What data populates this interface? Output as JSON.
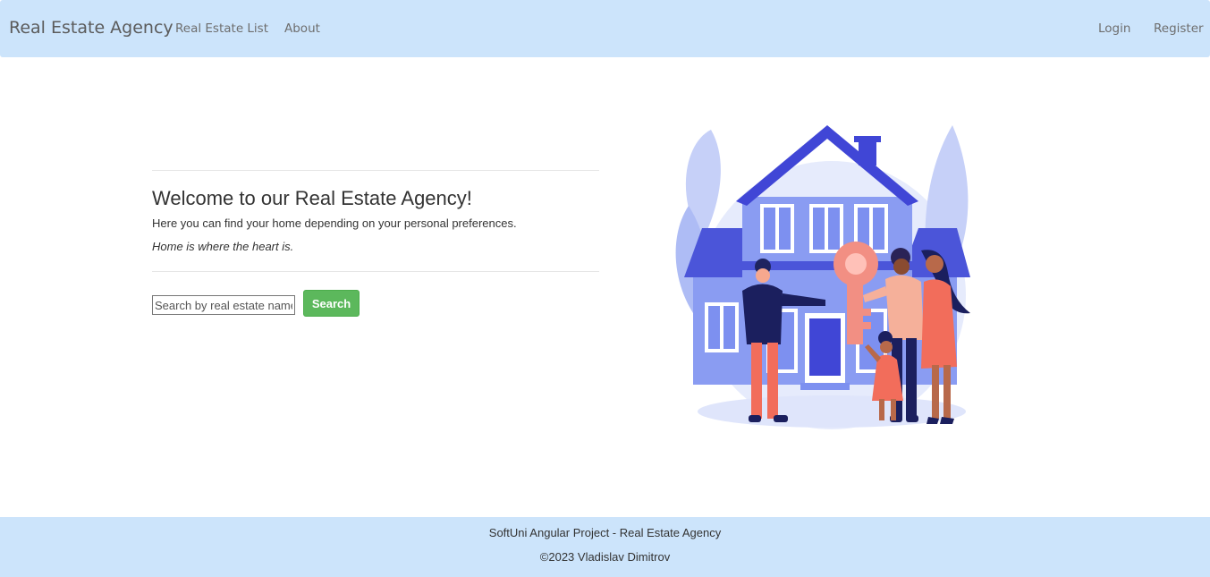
{
  "navbar": {
    "brand": "Real Estate Agency",
    "links": [
      "Real Estate List",
      "About"
    ],
    "auth": [
      "Login",
      "Register"
    ]
  },
  "main": {
    "title": "Welcome to our Real Estate Agency!",
    "subtitle": "Here you can find your home depending on your personal preferences.",
    "motto": "Home is where the heart is.",
    "search": {
      "placeholder": "Search by real estate name",
      "value": "",
      "button_label": "Search"
    }
  },
  "footer": {
    "line1": "SoftUni Angular Project - Real Estate Agency",
    "line2": "©2023 Vladislav Dimitrov"
  },
  "colors": {
    "navbar_bg": "#cce4fb",
    "search_button": "#5cb85c",
    "house_blue": "#7b8ff0",
    "accent_coral": "#f26d5b"
  }
}
